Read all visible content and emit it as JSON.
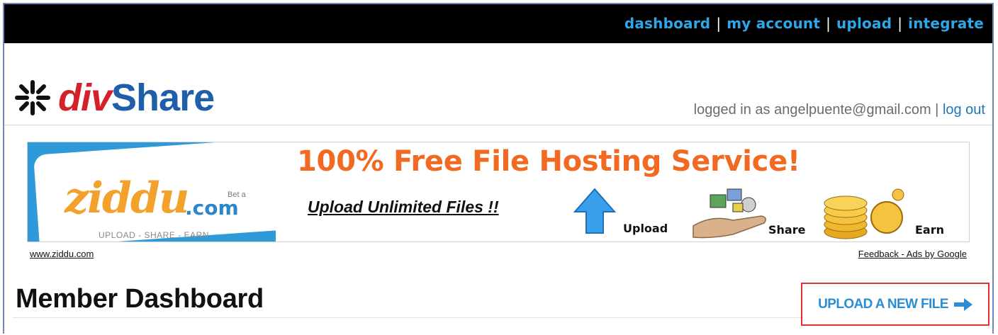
{
  "topnav": {
    "items": [
      "dashboard",
      "my account",
      "upload",
      "integrate"
    ],
    "separator": "|"
  },
  "logo": {
    "part1": "div",
    "part2": "Share"
  },
  "login": {
    "prefix": "logged in as angelpuente@gmail.com |",
    "logout": "log out"
  },
  "ad": {
    "brand": "ziddu",
    "brand_suffix": ".com",
    "beta": "Bet a",
    "tagline": "UPLOAD - SHARE - EARN",
    "headline": "100% Free File Hosting Service!",
    "subline": "Upload Unlimited Files !!",
    "items": [
      "Upload",
      "Share",
      "Earn"
    ],
    "footer_left": "www.ziddu.com",
    "footer_right": "Feedback - Ads by Google"
  },
  "page": {
    "title": "Member Dashboard",
    "upload_button": "UPLOAD A NEW FILE"
  },
  "colors": {
    "nav_link": "#2ea6e8",
    "logo_red": "#d42028",
    "logo_blue": "#1f5ea8",
    "ad_orange": "#f26a21",
    "highlight_border": "#e23131"
  }
}
